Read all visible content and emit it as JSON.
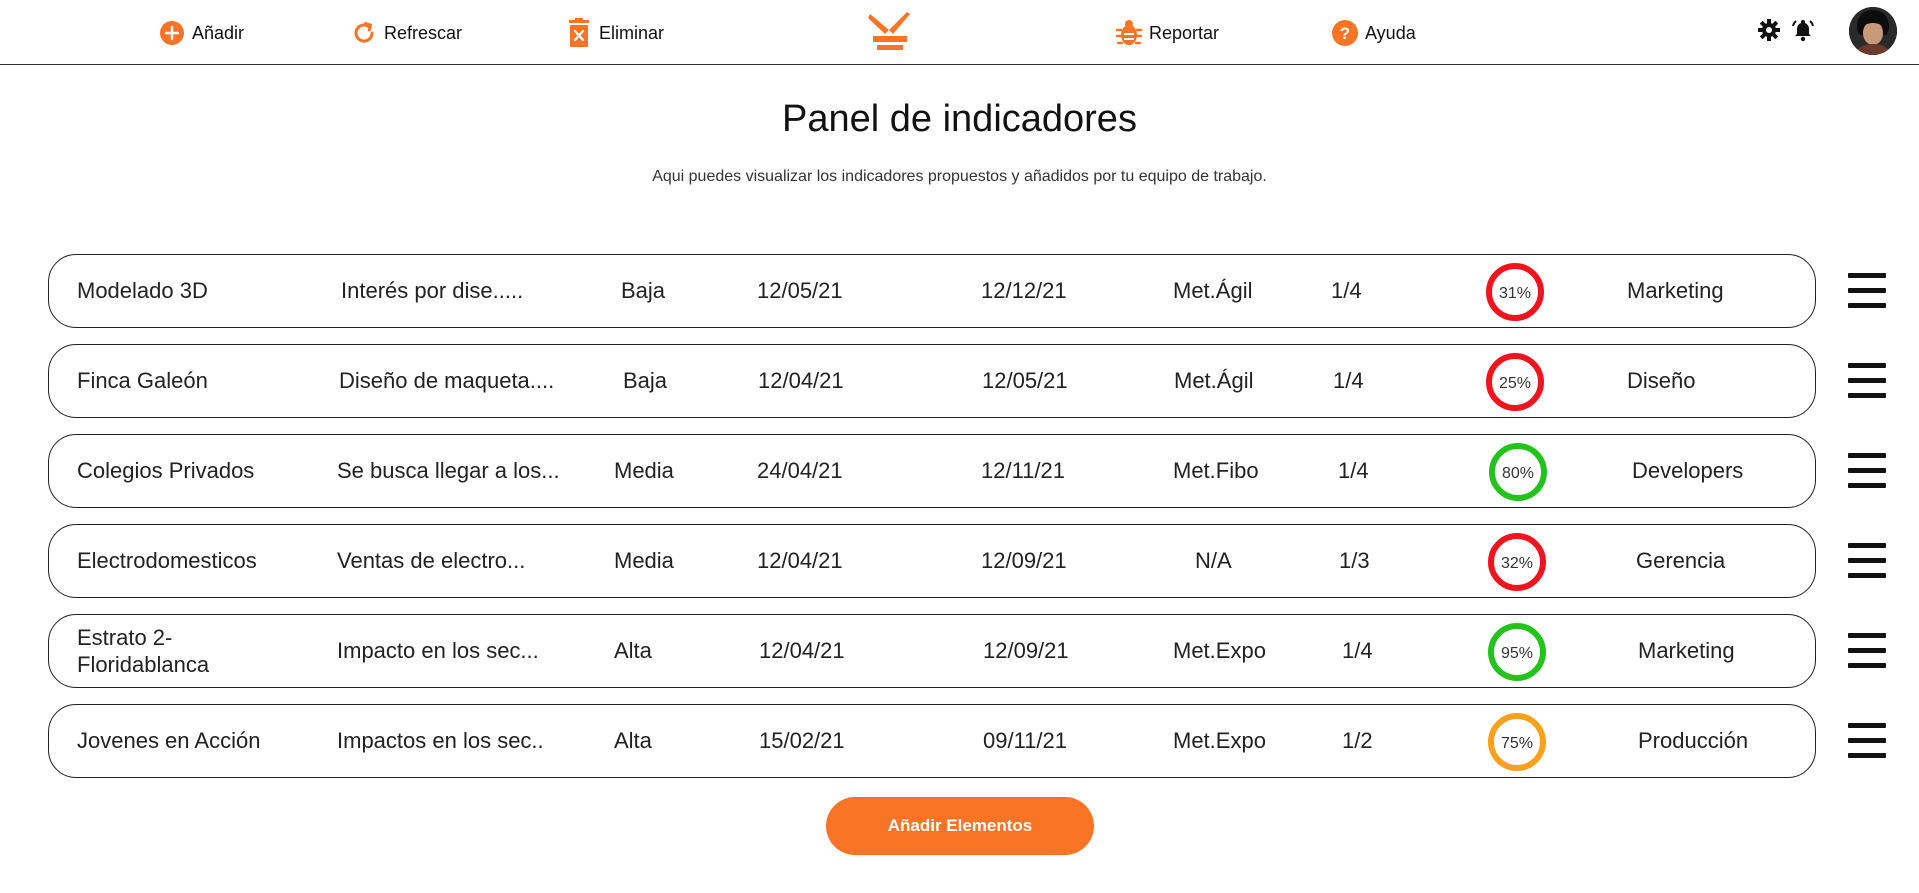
{
  "toolbar": {
    "add_label": "Añadir",
    "refresh_label": "Refrescar",
    "delete_label": "Eliminar",
    "report_label": "Reportar",
    "help_label": "Ayuda"
  },
  "header": {
    "title": "Panel de indicadores",
    "subtitle": "Aqui puedes visualizar los indicadores propuestos y añadidos por tu equipo de trabajo."
  },
  "colors": {
    "accent": "#fa7426",
    "low": "#f0141e",
    "high": "#22c41c",
    "mid": "#f9a11b"
  },
  "icons": [
    "plus-circle-icon",
    "refresh-icon",
    "trash-icon",
    "brand-logo",
    "bug-icon",
    "help-icon",
    "gear-icon",
    "bell-icon",
    "menu-icon"
  ],
  "indicators": [
    {
      "name": "Modelado 3D",
      "description": "Interés por dise.....",
      "priority": "Baja",
      "start": "12/05/21",
      "end": "12/12/21",
      "method": "Met.Ágil",
      "phase": "1/4",
      "progress_label": "31%",
      "progress": 31,
      "status": "low",
      "team": "Marketing"
    },
    {
      "name": "Finca Galeón",
      "description": "Diseño de maqueta....",
      "priority": "Baja",
      "start": "12/04/21",
      "end": "12/05/21",
      "method": "Met.Ágil",
      "phase": "1/4",
      "progress_label": "25%",
      "progress": 25,
      "status": "low",
      "team": "Diseño"
    },
    {
      "name": "Colegios Privados",
      "description": "Se busca llegar a los...",
      "priority": "Media",
      "start": "24/04/21",
      "end": "12/11/21",
      "method": "Met.Fibo",
      "phase": "1/4",
      "progress_label": "80%",
      "progress": 80,
      "status": "high",
      "team": "Developers"
    },
    {
      "name": "Electrodomesticos",
      "description": "Ventas de electro...",
      "priority": "Media",
      "start": "12/04/21",
      "end": "12/09/21",
      "method": "N/A",
      "phase": "1/3",
      "progress_label": "32%",
      "progress": 32,
      "status": "low",
      "team": "Gerencia"
    },
    {
      "name": "Estrato 2- Floridablanca",
      "description": "Impacto en los sec...",
      "priority": "Alta",
      "start": "12/04/21",
      "end": "12/09/21",
      "method": "Met.Expo",
      "phase": "1/4",
      "progress_label": "95%",
      "progress": 95,
      "status": "high",
      "team": "Marketing"
    },
    {
      "name": "Jovenes en Acción",
      "description": "Impactos en los sec..",
      "priority": "Alta",
      "start": "15/02/21",
      "end": "09/11/21",
      "method": "Met.Expo",
      "phase": "1/2",
      "progress_label": "75%",
      "progress": 75,
      "status": "mid",
      "team": "Producción"
    }
  ],
  "footer": {
    "add_elements_label": "Añadir Elementos"
  }
}
